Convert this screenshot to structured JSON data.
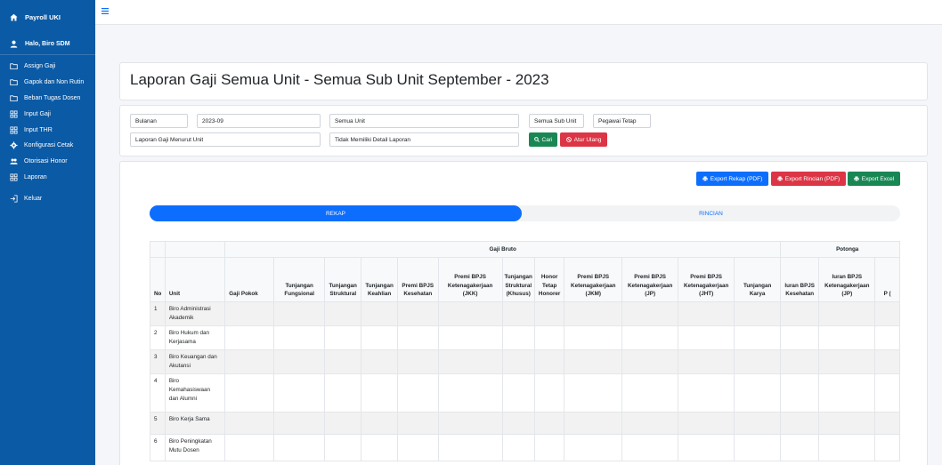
{
  "app": {
    "brand": "Payroll UKI",
    "user_greeting": "Halo, Biro SDM"
  },
  "sidebar": {
    "items": [
      {
        "label": "Assign Gaji",
        "icon": "folder-icon"
      },
      {
        "label": "Gapok dan Non Rutin",
        "icon": "folder-icon"
      },
      {
        "label": "Beban Tugas Dosen",
        "icon": "folder-icon"
      },
      {
        "label": "Input Gaji",
        "icon": "grid-icon"
      },
      {
        "label": "Input THR",
        "icon": "grid-icon"
      },
      {
        "label": "Konfigurasi Cetak",
        "icon": "gear-icon"
      },
      {
        "label": "Otorisasi Honor",
        "icon": "users-icon"
      },
      {
        "label": "Laporan",
        "icon": "grid-icon"
      }
    ],
    "logout": "Keluar"
  },
  "page": {
    "title": "Laporan Gaji Semua Unit - Semua Sub Unit September - 2023"
  },
  "filters": {
    "period_type": "Bulanan",
    "period": "2023-09",
    "unit": "Semua Unit",
    "sub_unit": "Semua Sub Unit",
    "employee_type": "Pegawai Tetap",
    "report_type": "Laporan Gaji Menurut Unit",
    "detail": "Tidak Memiliki Detail Laporan",
    "search_btn": "Cari",
    "reset_btn": "Atur Ulang"
  },
  "exports": {
    "rekap_pdf": "Export Rekap (PDF)",
    "rincian_pdf": "Export Rincian (PDF)",
    "excel": "Export Excel"
  },
  "tabs": {
    "rekap": "REKAP",
    "rincian": "RINCIAN"
  },
  "table": {
    "group_bruto": "Gaji Bruto",
    "group_potongan": "Potonga",
    "col_no": "No",
    "col_unit": "Unit",
    "bruto_cols": [
      "Gaji Pokok",
      "Tunjangan Fungsional",
      "Tunjangan Struktural",
      "Tunjangan Keahlian",
      "Premi BPJS Kesehatan",
      "Premi BPJS Ketenagakerjaan (JKK)",
      "Tunjangan Struktural (Khusus)",
      "Honor Tetap Honorer",
      "Premi BPJS Ketenagakerjaan (JKM)",
      "Premi BPJS Ketenagakerjaan (JP)",
      "Premi BPJS Ketenagakerjaan (JHT)",
      "Tunjangan Karya"
    ],
    "potongan_cols": [
      "Iuran BPJS Kesehatan",
      "Iuran BPJS Ketenagakerjaan (JP)",
      "P ("
    ],
    "rows": [
      {
        "no": "1",
        "unit": "Biro Administrasi Akademik"
      },
      {
        "no": "2",
        "unit": "Biro Hukum dan Kerjasama"
      },
      {
        "no": "3",
        "unit": "Biro Keuangan dan Akutansi"
      },
      {
        "no": "4",
        "unit": "Biro Kemahasiswaan dan Alumni"
      },
      {
        "no": "5",
        "unit": "Biro Kerja Sama"
      },
      {
        "no": "6",
        "unit": "Biro Peningkatan Mutu Dosen"
      }
    ]
  },
  "colors": {
    "sidebar": "#0b5aa5",
    "primary": "#0d6efd",
    "success": "#198754",
    "danger": "#dc3545"
  }
}
